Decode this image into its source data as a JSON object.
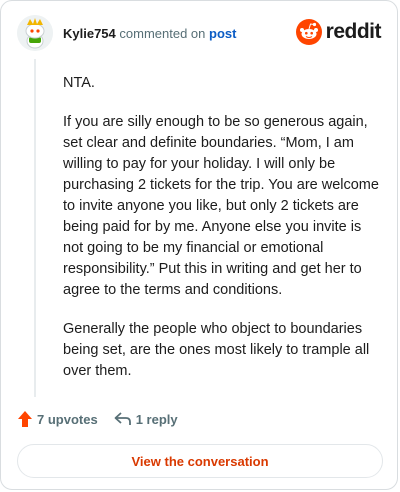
{
  "header": {
    "username": "Kylie754",
    "action_text": "commented on",
    "post_link": "post",
    "brand": "reddit"
  },
  "comment": {
    "paragraphs": [
      "NTA.",
      "If you are silly enough to be so generous again, set clear and definite boundaries. “Mom, I am willing to pay for your holiday. I will only be purchasing 2 tickets for the trip. You are welcome to invite anyone you like, but only 2 tickets are being paid for by me. Anyone else you invite is not going to be my financial or emotional responsibility.” Put this in writing and get her to agree to the terms and conditions.",
      "Generally the people who object to boundaries being set, are the ones most likely to trample all over them."
    ]
  },
  "actions": {
    "upvotes": "7 upvotes",
    "replies": "1 reply"
  },
  "footer": {
    "view_button": "View the conversation"
  },
  "colors": {
    "reddit_orange": "#ff4500",
    "link_blue": "#0b5cc5",
    "button_text": "#d93900"
  },
  "icons": {
    "avatar": "snoo-avatar-icon",
    "brand": "reddit-logo-icon",
    "upvote": "upvote-arrow-icon",
    "reply": "reply-arrow-icon"
  }
}
